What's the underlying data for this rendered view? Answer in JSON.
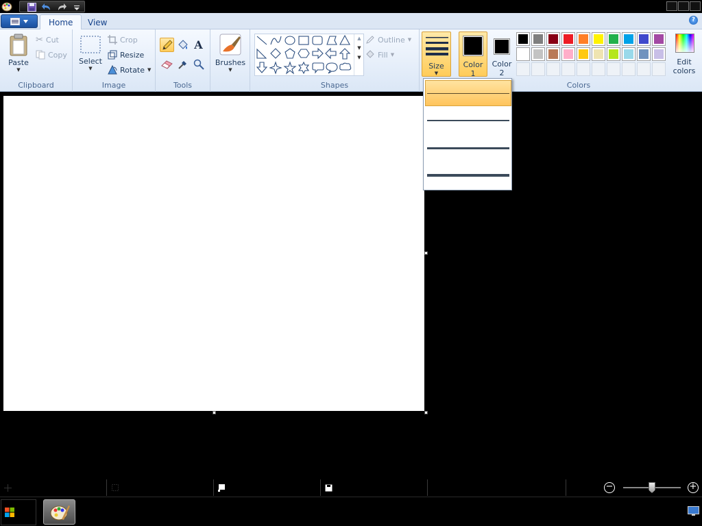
{
  "tabs": {
    "home": "Home",
    "view": "View"
  },
  "clipboard": {
    "paste": "Paste",
    "cut": "Cut",
    "copy": "Copy",
    "group": "Clipboard"
  },
  "image": {
    "select": "Select",
    "crop": "Crop",
    "resize": "Resize",
    "rotate": "Rotate",
    "group": "Image"
  },
  "tools": {
    "group": "Tools"
  },
  "brushes": {
    "label": "Brushes"
  },
  "shapes": {
    "outline": "Outline",
    "fill": "Fill",
    "group": "Shapes"
  },
  "size": {
    "label": "Size",
    "options": [
      1,
      2,
      3,
      4
    ],
    "selected_index": 0
  },
  "colors": {
    "color1": {
      "label_line1": "Color",
      "label_line2": "1",
      "value": "#000000"
    },
    "color2": {
      "label_line1": "Color",
      "label_line2": "2",
      "value": "#000000"
    },
    "edit_line1": "Edit",
    "edit_line2": "colors",
    "group": "Colors",
    "palette_row1": [
      "#000000",
      "#7f7f7f",
      "#880015",
      "#ed1c24",
      "#ff7f27",
      "#fff200",
      "#22b14c",
      "#00a2e8",
      "#3f48cc",
      "#a349a4"
    ],
    "palette_row2": [
      "#ffffff",
      "#c3c3c3",
      "#b97a57",
      "#ffaec9",
      "#ffc90e",
      "#efe4b0",
      "#b5e61d",
      "#99d9ea",
      "#7092be",
      "#c8bfe7"
    ]
  },
  "icons": {
    "app": "paint-app-icon",
    "save": "save-icon",
    "undo": "undo-icon",
    "redo": "redo-icon",
    "help": "help-icon",
    "zoom_in": "zoom-in-icon",
    "zoom_out": "zoom-out-icon"
  },
  "help_glyph": "?"
}
